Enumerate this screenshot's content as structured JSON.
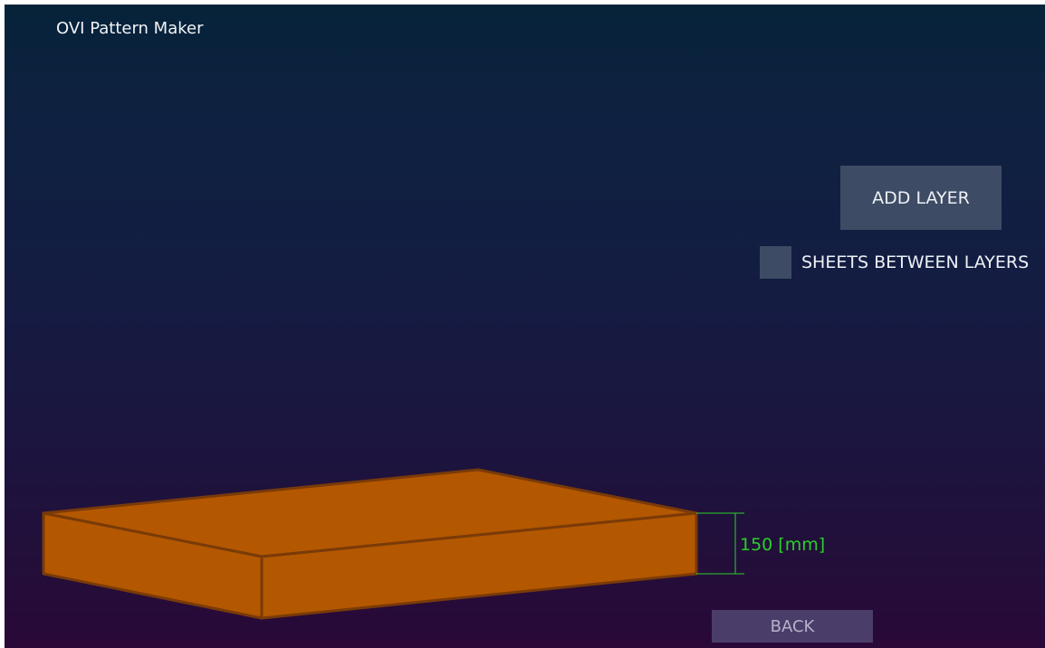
{
  "app": {
    "title": "OVI Pattern Maker"
  },
  "controls": {
    "add_layer_label": "ADD LAYER",
    "sheets_between_layers_label": "SHEETS BETWEEN LAYERS",
    "sheets_between_layers_checked": false,
    "back_label": "BACK"
  },
  "pallet": {
    "height_label": "150 [mm]",
    "color": "#b35800",
    "edge_color": "#7a3a08",
    "dimension_color": "#2ad02a"
  }
}
